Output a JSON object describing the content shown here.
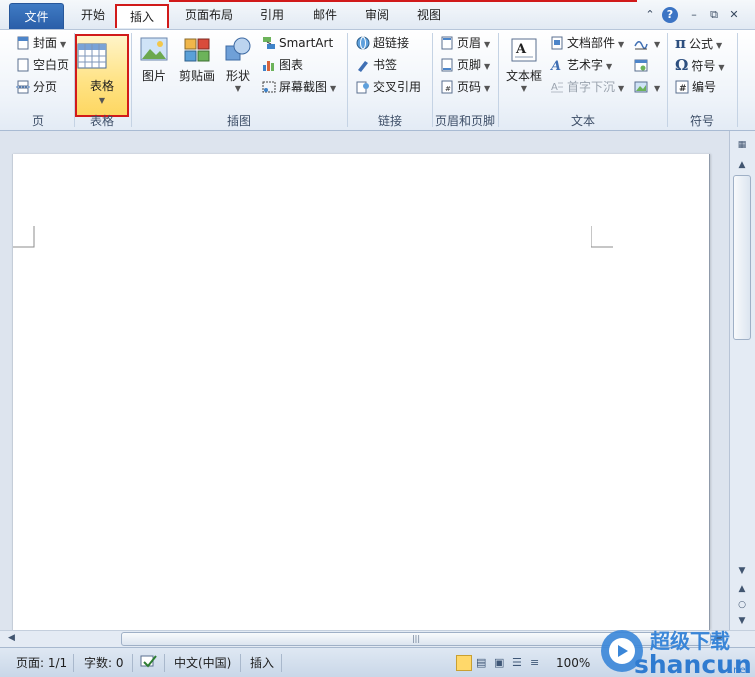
{
  "tabs": {
    "file": "文件",
    "home": "开始",
    "insert": "插入",
    "page_layout": "页面布局",
    "references": "引用",
    "mailings": "邮件",
    "review": "审阅",
    "view": "视图"
  },
  "groups": {
    "pages": {
      "label": "页",
      "cover": "封面",
      "blank": "空白页",
      "break": "分页"
    },
    "tables": {
      "label": "表格",
      "table": "表格"
    },
    "illustrations": {
      "label": "插图",
      "picture": "图片",
      "clipart": "剪贴画",
      "shapes": "形状",
      "smartart": "SmartArt",
      "chart": "图表",
      "screenshot": "屏幕截图"
    },
    "links": {
      "label": "链接",
      "hyperlink": "超链接",
      "bookmark": "书签",
      "crossref": "交叉引用"
    },
    "header_footer": {
      "label": "页眉和页脚",
      "header": "页眉",
      "footer": "页脚",
      "page_number": "页码"
    },
    "text": {
      "label": "文本",
      "textbox": "文本框",
      "quickparts": "文档部件",
      "wordart": "艺术字",
      "dropcap": "首字下沉"
    },
    "symbols": {
      "label": "符号",
      "equation": "公式",
      "symbol": "符号",
      "numbering": "编号"
    }
  },
  "status": {
    "page": "页面: 1/1",
    "words": "字数: 0",
    "language": "中文(中国)",
    "mode": "插入",
    "zoom": "100%"
  },
  "watermark": {
    "line1": "超级下载",
    "line2": "shancun",
    "suffix": ".net"
  },
  "colors": {
    "file_tab": "#2a5ea8",
    "highlight_box": "#d11a1a",
    "table_button_bg": "#ffe282",
    "ribbon_bg": "#eef3f9"
  }
}
